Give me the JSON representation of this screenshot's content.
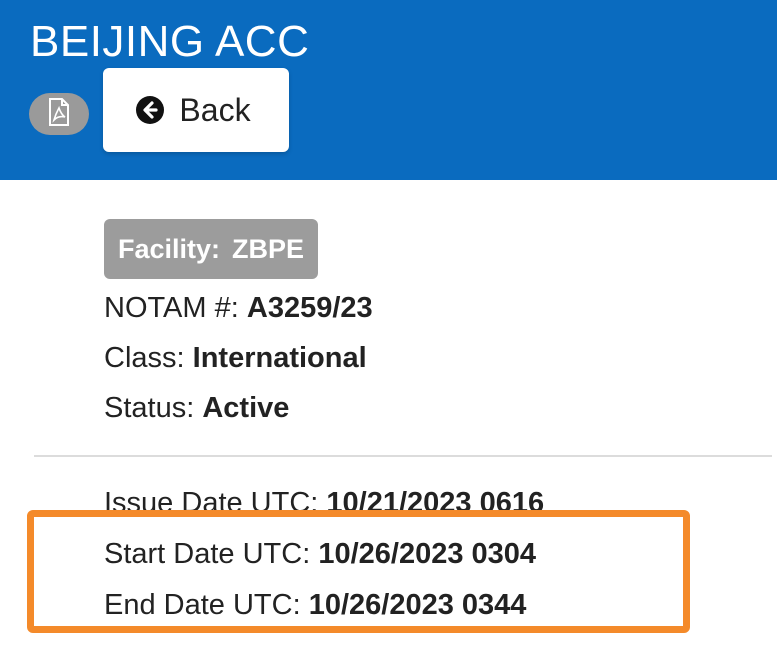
{
  "header": {
    "title": "BEIJING ACC",
    "back_label": "Back",
    "pdf_icon": "pdf-file-icon",
    "back_icon": "circle-arrow-left-icon",
    "color": "#0a6bbf"
  },
  "facility": {
    "label": "Facility:",
    "value": "ZBPE"
  },
  "details": {
    "notam": {
      "label": "NOTAM #:",
      "value": "A3259/23"
    },
    "class": {
      "label": "Class:",
      "value": "International"
    },
    "status": {
      "label": "Status:",
      "value": "Active"
    }
  },
  "dates": {
    "issue": {
      "label": "Issue Date UTC:",
      "value": "10/21/2023 0616"
    },
    "start": {
      "label": "Start Date UTC:",
      "value": "10/26/2023 0304"
    },
    "end": {
      "label": "End Date UTC:",
      "value": "10/26/2023 0344"
    }
  },
  "colors": {
    "highlight": "#f48a2a",
    "badge": "#9c9c9c"
  }
}
